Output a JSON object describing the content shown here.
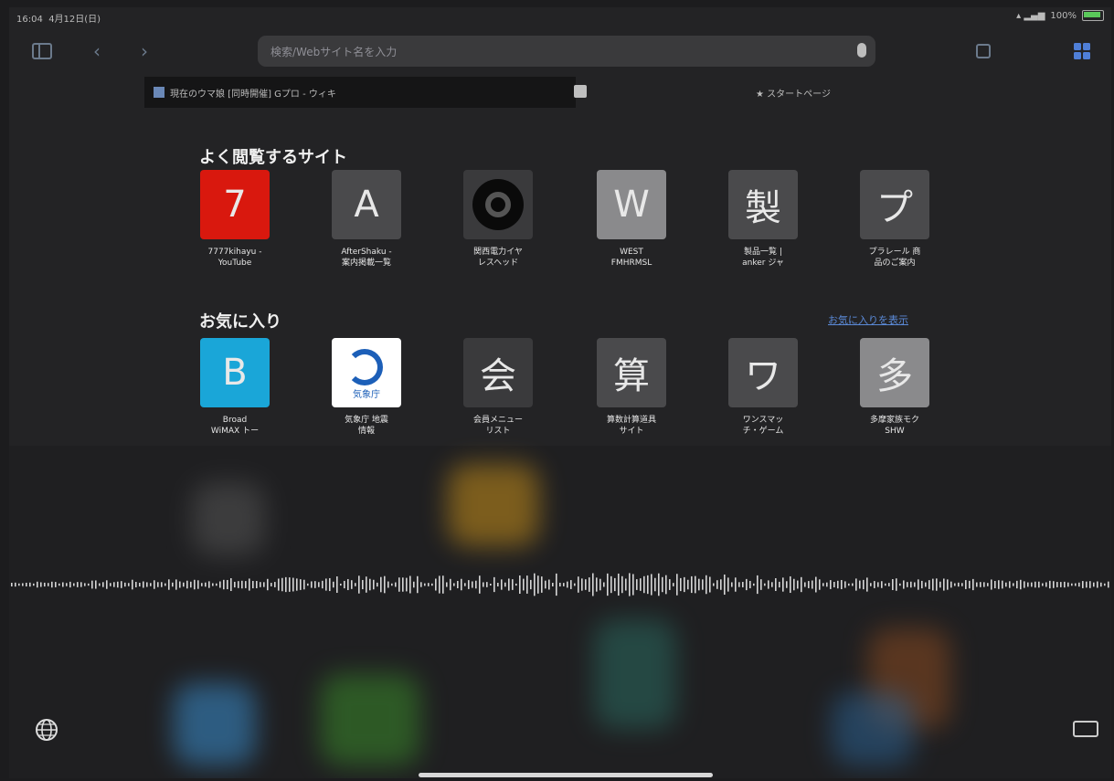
{
  "status": {
    "time": "16:04",
    "date": "4月12日(日)",
    "battery": "100%"
  },
  "toolbar": {
    "sidebar_icon": "sidebar-icon",
    "back_icon": "chevron-left-icon",
    "forward_icon": "chevron-right-icon",
    "address_placeholder": "検索/Webサイト名を入力",
    "tabs_icon": "tabs-overview-icon",
    "new_tab_icon": "new-tab-icon"
  },
  "tabs": [
    {
      "label": "現在のウマ娘 [同時開催] Gプロ - ウィキ"
    },
    {
      "label": "★ スタートページ"
    }
  ],
  "frequent": {
    "title": "よく閲覧するサイト",
    "items": [
      {
        "letter": "7",
        "caption": "7777kihayu -\nYouTube",
        "bg": "#d9180e"
      },
      {
        "letter": "A",
        "caption": "AfterShaku -\n案内掲載一覧",
        "bg": "#4a4a4c"
      },
      {
        "letter": "",
        "caption": "関西電力イヤ\nレスヘッド",
        "bg": "#3a3a3c",
        "icon": "beats-logo"
      },
      {
        "letter": "W",
        "caption": "WEST\nFMHRMSL",
        "bg": "#8a8a8c"
      },
      {
        "letter": "製",
        "caption": "製品一覧 |\nanker ジャ",
        "bg": "#4a4a4c"
      },
      {
        "letter": "プ",
        "caption": "プラレール 商\n品のご案内",
        "bg": "#4a4a4c"
      }
    ]
  },
  "favorites": {
    "title": "お気に入り",
    "show_all": "お気に入りを表示",
    "items": [
      {
        "letter": "B",
        "caption": "Broad\nWiMAX トー",
        "bg": "#1aa6d8"
      },
      {
        "letter": "",
        "caption": "気象庁 地震\n情報",
        "bg": "#ffffff",
        "icon": "kishocho-logo",
        "logo_text": "気象庁"
      },
      {
        "letter": "会",
        "caption": "会員メニュー\nリスト",
        "bg": "#3a3a3c"
      },
      {
        "letter": "算",
        "caption": "算数計算道具\nサイト",
        "bg": "#4a4a4c"
      },
      {
        "letter": "ワ",
        "caption": "ワンスマッ\nチ・ゲーム",
        "bg": "#4a4a4c"
      },
      {
        "letter": "多",
        "caption": "多摩家族モク\nSHW",
        "bg": "#8a8a8c"
      }
    ]
  },
  "bottom": {
    "globe_icon": "globe-icon",
    "keyboard_icon": "keyboard-icon"
  }
}
